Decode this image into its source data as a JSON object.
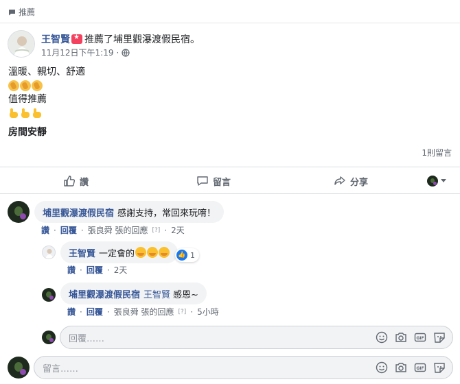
{
  "header": {
    "label": "推薦",
    "icon": "speech-bubble-icon"
  },
  "post": {
    "author": "王智賢",
    "action_text": "推薦了埔里觀瀑渡假民宿。",
    "time": "11月12日下午1:19",
    "privacy_icon": "globe-icon",
    "lines": [
      "溫暖、親切、舒適",
      "值得推薦",
      "房間安靜"
    ],
    "comment_count": "1則留言"
  },
  "actions": {
    "like": "讚",
    "comment": "留言",
    "share": "分享"
  },
  "comments": [
    {
      "author": "埔里觀瀑渡假民宿",
      "text": "感謝支持，常回來玩唷！",
      "like": "讚",
      "reply": "回覆",
      "edited_by": "張良舜 張的回應",
      "tiny": "[?]",
      "time": "2天"
    },
    {
      "author": "王智賢",
      "text": "一定會的",
      "like": "讚",
      "reply": "回覆",
      "time": "2天",
      "reaction_count": "1"
    },
    {
      "author": "埔里觀瀑渡假民宿",
      "tag": "王智賢",
      "text": "感恩~",
      "like": "讚",
      "reply": "回覆",
      "edited_by": "張良舜 張的回應",
      "tiny": "[?]",
      "time": "5小時"
    }
  ],
  "reply_box": {
    "placeholder": "回覆……"
  },
  "comment_box": {
    "placeholder": "留言……"
  },
  "colors": {
    "link": "#385898",
    "bubble": "#f2f3f5",
    "like": "#1877f2"
  }
}
